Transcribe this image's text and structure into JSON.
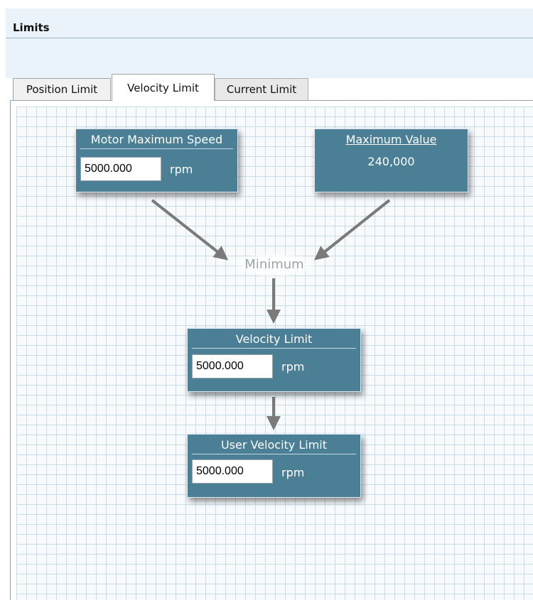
{
  "window": {
    "title": "Limits"
  },
  "tabs": [
    {
      "label": "Position Limit"
    },
    {
      "label": "Velocity Limit"
    },
    {
      "label": "Current Limit"
    }
  ],
  "diagram": {
    "motor_max_speed": {
      "title": "Motor Maximum Speed",
      "value": "5000.000",
      "unit": "rpm"
    },
    "maximum_value": {
      "title": "Maximum Value",
      "value": "240,000"
    },
    "minimum": {
      "label": "Minimum"
    },
    "velocity_limit": {
      "title": "Velocity Limit",
      "value": "5000.000",
      "unit": "rpm"
    },
    "user_velocity_limit": {
      "title": "User Velocity Limit",
      "value": "5000.000",
      "unit": "rpm"
    }
  },
  "colors": {
    "node_fill": "#4b7f96",
    "arrow": "#7a7a7a",
    "grid_line": "#c9dde9",
    "title_bar": "#eaf3f9"
  }
}
